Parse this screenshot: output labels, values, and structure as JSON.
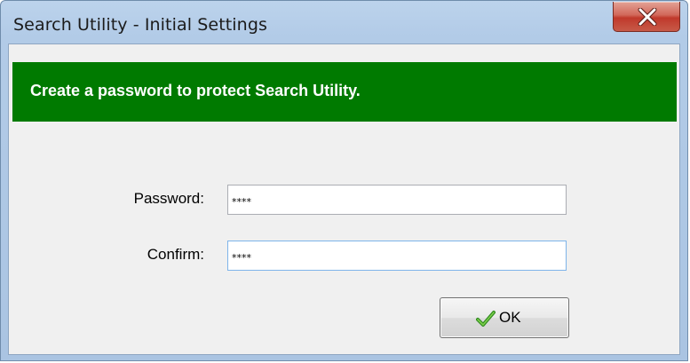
{
  "window": {
    "title": "Search Utility - Initial Settings"
  },
  "banner": {
    "message": "Create a password to protect Search Utility.",
    "color": "#007a00"
  },
  "form": {
    "password_label": "Password:",
    "password_value": "****",
    "confirm_label": "Confirm:",
    "confirm_value": "****"
  },
  "buttons": {
    "ok_label": "OK",
    "ok_icon": "checkmark-icon",
    "close_icon": "close-icon"
  }
}
